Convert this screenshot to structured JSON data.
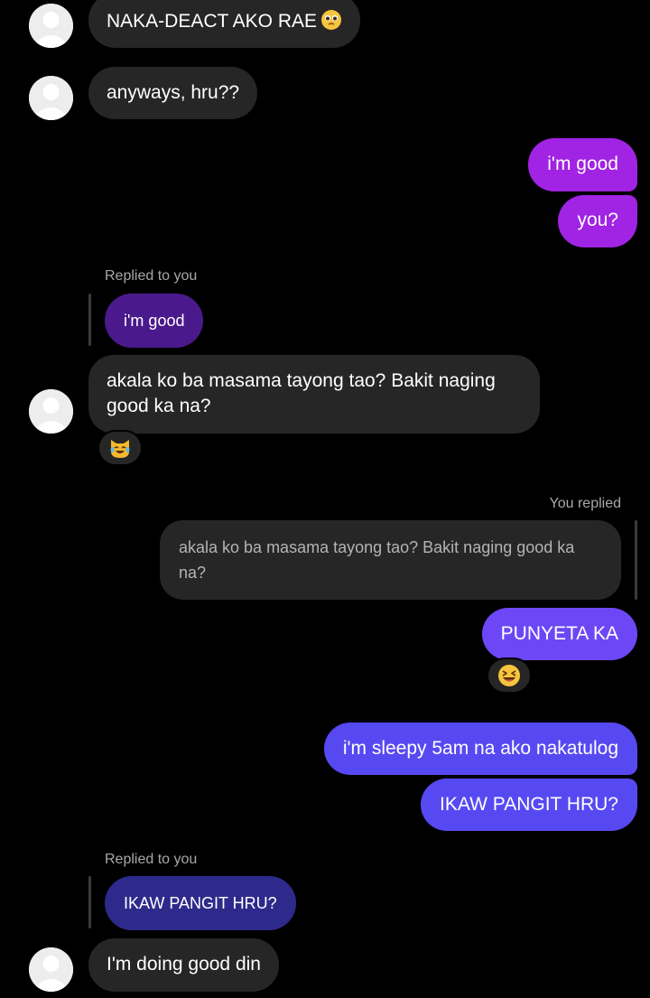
{
  "colors": {
    "background": "#000000",
    "incoming_bubble": "#262626",
    "outgoing_purple": "#a123e3",
    "outgoing_violet": "#6d47f6",
    "outgoing_indigo": "#5749f2",
    "quote_purple": "#4a1a8c",
    "quote_indigo": "#2e2a8c",
    "meta_text": "#a8a8a8"
  },
  "messages": {
    "m1": {
      "text": "NAKA-DEACT AKO RAE",
      "emoji": "pleading-face-icon"
    },
    "m2": {
      "text": "anyways, hru??"
    },
    "m3": {
      "text": "i'm good"
    },
    "m4": {
      "text": "you?"
    },
    "reply1": {
      "label": "Replied to you",
      "quote": "i'm good"
    },
    "m5": {
      "line1": "akala ko ba masama tayong tao? Bakit naging",
      "line2": "good ka na?",
      "reaction": "cat-tears-of-joy-icon"
    },
    "reply2": {
      "label": "You replied",
      "quote_line1": "akala ko ba masama tayong tao? Bakit naging good ka",
      "quote_line2": "na?"
    },
    "m6": {
      "text": "PUNYETA KA",
      "reaction": "laughing-squint-face-icon"
    },
    "m7": {
      "text": "i'm sleepy 5am na ako nakatulog"
    },
    "m8": {
      "text": "IKAW PANGIT HRU?"
    },
    "reply3": {
      "label": "Replied to you",
      "quote": "IKAW PANGIT HRU?"
    },
    "m9": {
      "text": "I'm doing good din"
    }
  }
}
